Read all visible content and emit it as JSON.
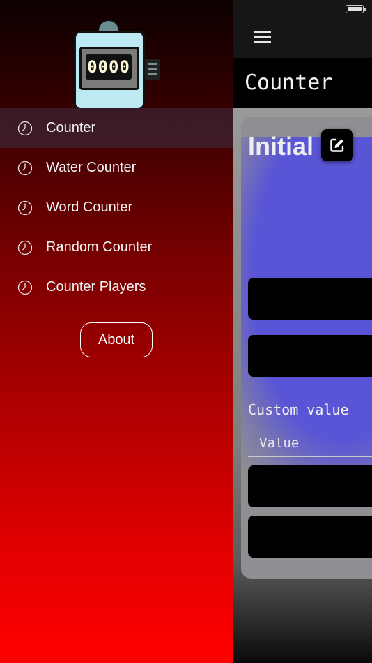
{
  "logo": {
    "display_digits": "0000"
  },
  "drawer": {
    "items": [
      {
        "label": "Counter",
        "active": true
      },
      {
        "label": "Water Counter",
        "active": false
      },
      {
        "label": "Word Counter",
        "active": false
      },
      {
        "label": "Random Counter",
        "active": false
      },
      {
        "label": "Counter Players",
        "active": false
      }
    ],
    "about_label": "About",
    "icon": "clock-icon"
  },
  "topbar": {
    "menu_icon": "hamburger-menu-icon"
  },
  "page": {
    "title": "Counter"
  },
  "card": {
    "initial_label": "Initial",
    "edit_icon": "edit-icon",
    "custom_label": "Custom value",
    "value_placeholder": "Value"
  },
  "colors": {
    "drawer_top": "#0c0000",
    "drawer_bottom": "#ff0000",
    "accent_blue": "#5a55d6",
    "active_item_bg": "#3c1e2d"
  }
}
